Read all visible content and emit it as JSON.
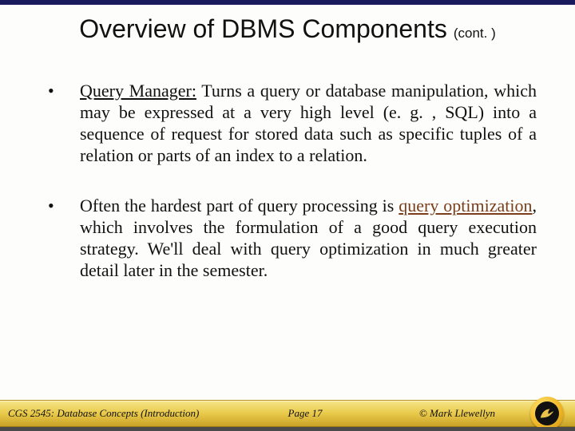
{
  "title": {
    "main": "Overview of DBMS Components",
    "suffix": "(cont. )"
  },
  "bullets": [
    {
      "term": "Query Manager:",
      "term_class": "term-underline",
      "rest": "   Turns a query or database manipulation, which may be expressed at a very high level (e. g. , SQL) into a sequence of request for stored data such as specific tuples of a relation or parts of an index to a relation."
    },
    {
      "pre": "Often the hardest part of query processing is ",
      "highlight": "query optimization",
      "highlight_class": "term-underline brown",
      "post": ", which involves the formulation of a good query execution strategy.  We'll deal with query optimization in much greater detail later in the semester."
    }
  ],
  "footer": {
    "left": "CGS 2545: Database Concepts  (Introduction)",
    "center": "Page 17",
    "right": "© Mark Llewellyn"
  }
}
